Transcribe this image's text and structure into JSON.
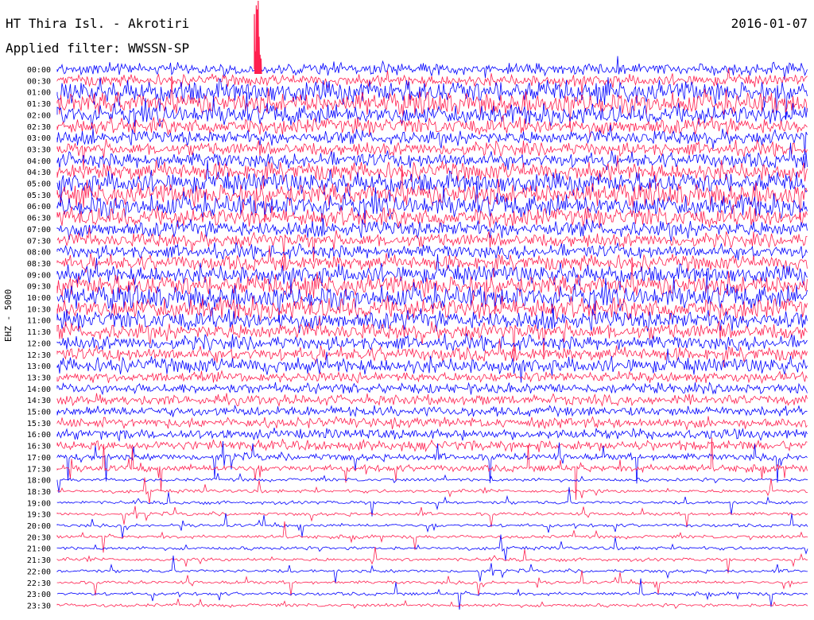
{
  "header": {
    "station": "HT Thira Isl. - Akrotiri",
    "date": "2016-01-07",
    "filter": "Applied filter: WWSSN-SP"
  },
  "channel_label": "EHZ - 5000",
  "colors": {
    "trace_a": "#0000ff",
    "trace_b": "#ff1f4f",
    "background": "#ffffff",
    "text": "#000000"
  },
  "chart_data": {
    "type": "line",
    "title": "HT Thira Isl. - Akrotiri",
    "ylabel": "EHZ - 5000",
    "tick_labels": [
      "00:00",
      "00:30",
      "01:00",
      "01:30",
      "02:00",
      "02:30",
      "03:00",
      "03:30",
      "04:00",
      "04:30",
      "05:00",
      "05:30",
      "06:00",
      "06:30",
      "07:00",
      "07:30",
      "08:00",
      "08:30",
      "09:00",
      "09:30",
      "10:00",
      "10:30",
      "11:00",
      "11:30",
      "12:00",
      "12:30",
      "13:00",
      "13:30",
      "14:00",
      "14:30",
      "15:00",
      "15:30",
      "16:00",
      "16:30",
      "17:00",
      "17:30",
      "18:00",
      "18:30",
      "19:00",
      "19:30",
      "20:00",
      "20:30",
      "21:00",
      "21:30",
      "22:00",
      "22:30",
      "23:00",
      "23:30"
    ],
    "rows": 48,
    "row_interval_minutes": 30,
    "trace_colors_alternate": [
      "blue",
      "red"
    ],
    "grid": false
  }
}
